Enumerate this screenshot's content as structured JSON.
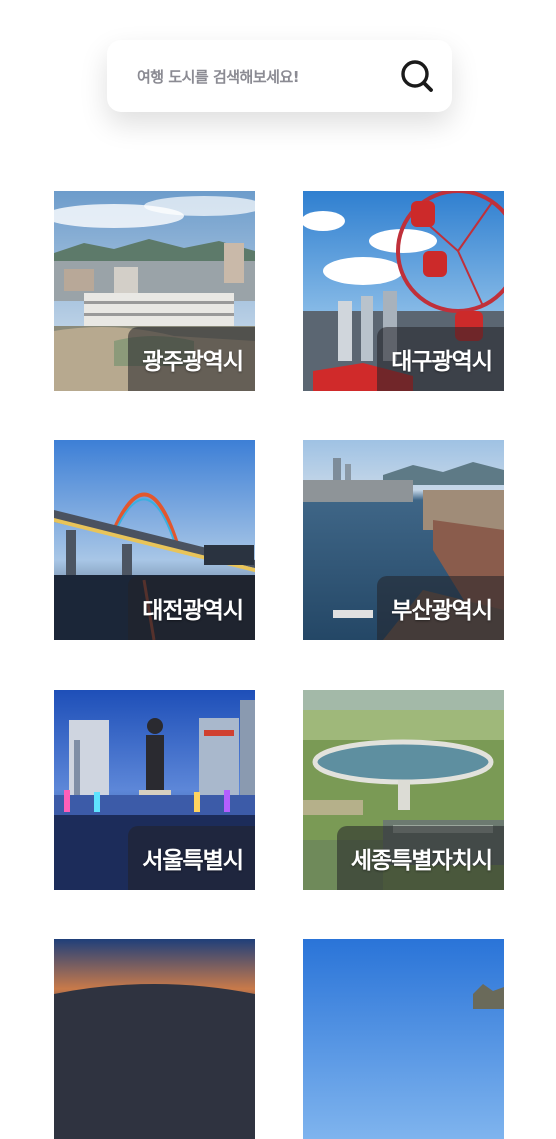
{
  "search": {
    "placeholder": "여행 도시를 검색해보세요!",
    "value": ""
  },
  "cities": [
    {
      "name": "광주광역시"
    },
    {
      "name": "대구광역시"
    },
    {
      "name": "대전광역시"
    },
    {
      "name": "부산광역시"
    },
    {
      "name": "서울특별시"
    },
    {
      "name": "세종특별자치시"
    },
    {
      "name": ""
    },
    {
      "name": ""
    }
  ]
}
